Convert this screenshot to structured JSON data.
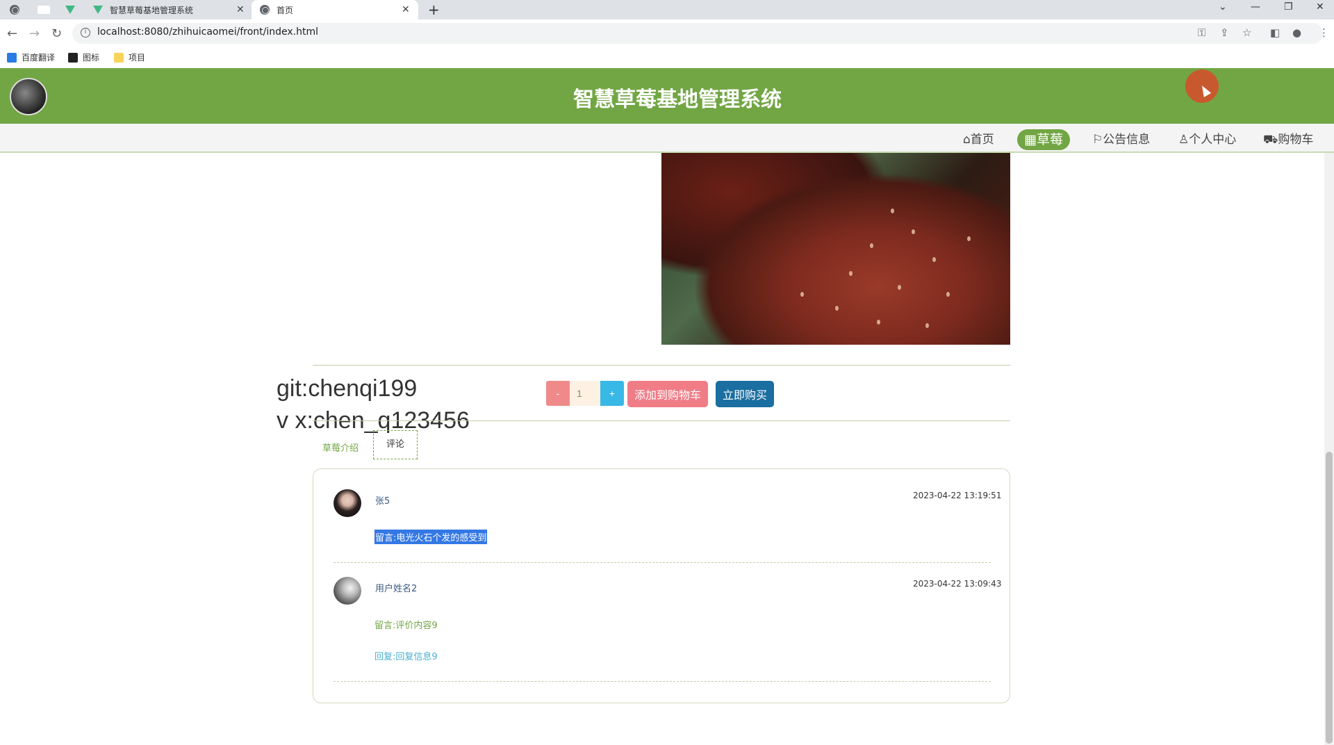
{
  "browser": {
    "tabs": [
      {
        "title": ""
      },
      {
        "title": ""
      },
      {
        "title": ""
      },
      {
        "title": "智慧草莓基地管理系统"
      },
      {
        "title": "首页"
      }
    ],
    "url": "localhost:8080/zhihuicaomei/front/index.html",
    "bookmarks": [
      "百度翻译",
      "图标",
      "项目"
    ]
  },
  "site": {
    "title": "智慧草莓基地管理系统",
    "nav": [
      {
        "label": "首页",
        "icon": "home-icon"
      },
      {
        "label": "草莓",
        "icon": "grid-icon",
        "active": true
      },
      {
        "label": "公告信息",
        "icon": "flag-icon"
      },
      {
        "label": "个人中心",
        "icon": "user-icon"
      },
      {
        "label": "购物车",
        "icon": "cart-icon"
      }
    ],
    "accent_color": "#72a644"
  },
  "product": {
    "watermark_line1": "git:chenqi199",
    "watermark_line2": "v x:chen_q123456",
    "quantity": "1",
    "minus_label": "-",
    "plus_label": "+",
    "add_to_cart_label": "添加到购物车",
    "buy_now_label": "立即购买"
  },
  "detail_tabs": {
    "intro": "草莓介绍",
    "comments": "评论"
  },
  "comments": [
    {
      "name": "张5",
      "time": "2023-04-22 13:19:51",
      "message": "留言:电光火石个发的感受到",
      "reply": ""
    },
    {
      "name": "用户姓名2",
      "time": "2023-04-22 13:09:43",
      "message": "留言:评价内容9",
      "reply": "回复:回复信息9"
    }
  ]
}
